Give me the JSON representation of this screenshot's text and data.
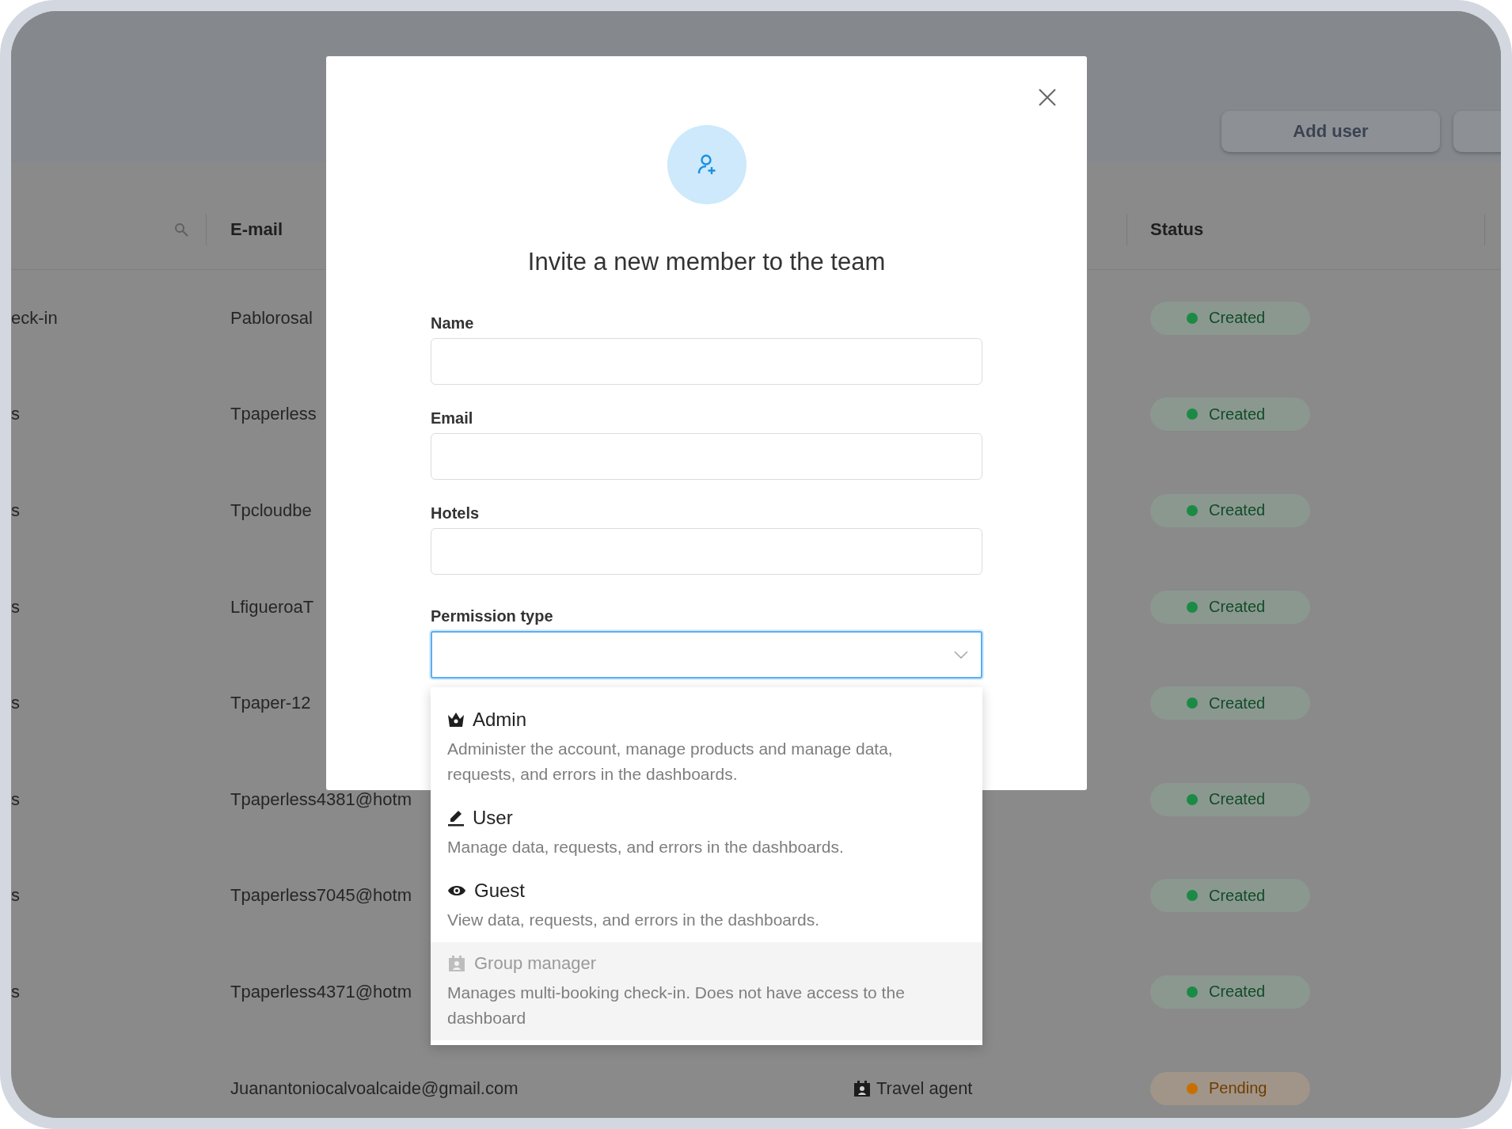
{
  "header": {
    "buttons": [
      {
        "label": "Add user"
      }
    ]
  },
  "table": {
    "columns": [
      {
        "label": "E-mail"
      },
      {
        "label": "Status"
      }
    ],
    "rows": [
      {
        "column_1": "eck-in",
        "email": "Pablorosal",
        "status": {
          "label": "Created",
          "color": "#1b8a45"
        }
      },
      {
        "column_1": "s",
        "email": "Tpaperless",
        "status": {
          "label": "Created",
          "color": "#1b8a45"
        }
      },
      {
        "column_1": "s",
        "email": "Tpcloudbe",
        "status": {
          "label": "Created",
          "color": "#1b8a45"
        }
      },
      {
        "column_1": "s",
        "email": "LfigueroaT",
        "status": {
          "label": "Created",
          "color": "#1b8a45"
        }
      },
      {
        "column_1": "s",
        "email": "Tpaper-12",
        "status": {
          "label": "Created",
          "color": "#1b8a45"
        }
      },
      {
        "column_1": "s",
        "email": "Tpaperless4381@hotm",
        "status": {
          "label": "Created",
          "color": "#1b8a45"
        }
      },
      {
        "column_1": "s",
        "email": "Tpaperless7045@hotm",
        "status": {
          "label": "Created",
          "color": "#1b8a45"
        }
      },
      {
        "column_1": "s",
        "email": "Tpaperless4371@hotm",
        "status": {
          "label": "Created",
          "color": "#1b8a45"
        }
      },
      {
        "email": "Juanantoniocalvoalcaide@gmail.com",
        "role": "Travel agent",
        "status": {
          "label": "Pending",
          "color": "#c96f00"
        }
      }
    ]
  },
  "modal": {
    "title": "Invite a new member to the team",
    "fields": [
      {
        "label": "Name",
        "kind": "text",
        "focused": false
      },
      {
        "label": "Email",
        "kind": "text",
        "focused": false
      },
      {
        "label": "Hotels",
        "kind": "text",
        "focused": false
      },
      {
        "label": "Permission type",
        "kind": "select",
        "focused": true
      }
    ],
    "permission_options": [
      {
        "title": "Admin",
        "kind": "crown",
        "description": "Administer the account, manage products and manage data, requests, and errors in the dashboards.",
        "disabled": false
      },
      {
        "title": "User",
        "kind": "pencil",
        "description": "Manage data, requests, and errors in the dashboards.",
        "disabled": false
      },
      {
        "title": "Guest",
        "kind": "eye",
        "description": "View data, requests, and errors in the dashboards.",
        "disabled": false
      },
      {
        "title": "Group manager",
        "kind": "badge",
        "description": "Manages multi-booking check-in. Does not have access to the dashboard",
        "disabled": true
      }
    ]
  }
}
